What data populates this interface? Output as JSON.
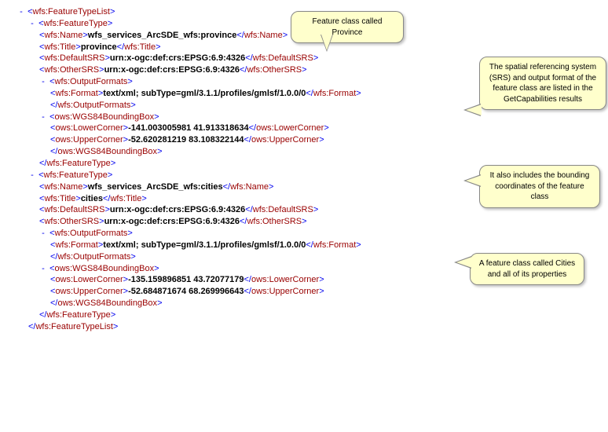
{
  "tags": {
    "featureTypeList_open": "wfs:FeatureTypeList",
    "featureTypeList_close": "wfs:FeatureTypeList",
    "featureType_open": "wfs:FeatureType",
    "featureType_close": "wfs:FeatureType",
    "name": "wfs:Name",
    "title": "wfs:Title",
    "defaultSRS": "wfs:DefaultSRS",
    "otherSRS": "wfs:OtherSRS",
    "outputFormats_open": "wfs:OutputFormats",
    "outputFormats_close": "wfs:OutputFormats",
    "format": "wfs:Format",
    "bbox_open": "ows:WGS84BoundingBox",
    "bbox_close": "ows:WGS84BoundingBox",
    "lowerCorner": "ows:LowerCorner",
    "upperCorner": "ows:UpperCorner"
  },
  "ft1": {
    "name": "wfs_services_ArcSDE_wfs:province",
    "title": "province",
    "defaultSRS": "urn:x-ogc:def:crs:EPSG:6.9:4326",
    "otherSRS": "urn:x-ogc:def:crs:EPSG:6.9:4326",
    "format": "text/xml; subType=gml/3.1.1/profiles/gmlsf/1.0.0/0",
    "lowerCorner": "-141.003005981 41.913318634",
    "upperCorner": "-52.620281219 83.108322144"
  },
  "ft2": {
    "name": "wfs_services_ArcSDE_wfs:cities",
    "title": "cities",
    "defaultSRS": "urn:x-ogc:def:crs:EPSG:6.9:4326",
    "otherSRS": "urn:x-ogc:def:crs:EPSG:6.9:4326",
    "format": "text/xml; subType=gml/3.1.1/profiles/gmlsf/1.0.0/0",
    "lowerCorner": "-135.159896851 43.72077179",
    "upperCorner": "-52.684871674 68.269996643"
  },
  "callouts": {
    "c1": "Feature class called Province",
    "c2": "The spatial referencing system (SRS) and output format of the feature class are listed in the GetCapabilities results",
    "c3": "It also includes the bounding coordinates of the feature class",
    "c4": "A feature class called Cities and all of its properties"
  },
  "sym": {
    "minus": "-"
  }
}
